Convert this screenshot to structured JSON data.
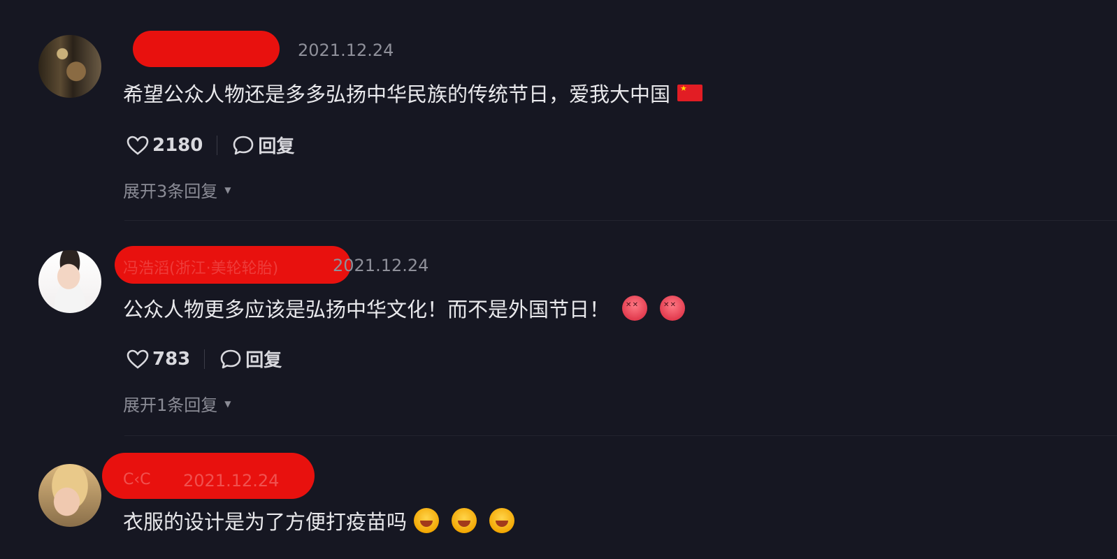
{
  "comments": [
    {
      "username": "",
      "date": "2021.12.24",
      "text": "希望公众人物还是多多弘扬中华民族的传统节日，爱我大中国",
      "likes": "2180",
      "reply_label": "回复",
      "expand_label": "展开3条回复"
    },
    {
      "username": "冯浩滔(浙江·美轮轮胎)",
      "date": "2021.12.24",
      "text": "公众人物更多应该是弘扬中华文化！而不是外国节日！",
      "likes": "783",
      "reply_label": "回复",
      "expand_label": "展开1条回复"
    },
    {
      "username": "C‹C",
      "date": "2021.12.24",
      "text": "衣服的设计是为了方便打疫苗吗"
    }
  ],
  "icons": {
    "like": "heart-outline-icon",
    "reply": "comment-bubble-icon",
    "expand": "caret-down-icon",
    "flag": "china-flag-emoji",
    "angry": "angry-face-emoji",
    "laugh": "laughing-face-emoji"
  },
  "colors": {
    "background": "#161722",
    "redaction": "#e8110e",
    "muted_text": "#8f909a",
    "primary_text": "#e9e9ec"
  }
}
